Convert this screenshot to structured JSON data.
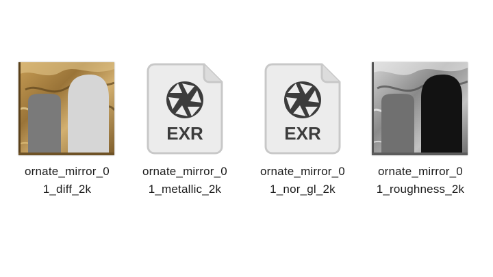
{
  "files": [
    {
      "name_line1": "ornate_mirror_0",
      "name_line2": "1_diff_2k",
      "thumbnail": "diffuse-texture-image",
      "colors": {
        "gold": "#b08a4a",
        "gold_dark": "#6e5226",
        "gray_panel": "#7a7a7a",
        "light_panel": "#d6d6d6"
      }
    },
    {
      "name_line1": "ornate_mirror_0",
      "name_line2": "1_metallic_2k",
      "thumbnail": "exr-file-icon",
      "badge": "EXR"
    },
    {
      "name_line1": "ornate_mirror_0",
      "name_line2": "1_nor_gl_2k",
      "thumbnail": "exr-file-icon",
      "badge": "EXR"
    },
    {
      "name_line1": "ornate_mirror_0",
      "name_line2": "1_roughness_2k",
      "thumbnail": "roughness-texture-image",
      "colors": {
        "frame_light": "#c9c9c9",
        "frame_mid": "#8a8a8a",
        "gray_panel": "#707070",
        "dark_panel": "#121212"
      }
    }
  ],
  "doc_icon_colors": {
    "body": "#ececec",
    "border": "#c8c8c8",
    "glyph": "#3c3c3c"
  }
}
